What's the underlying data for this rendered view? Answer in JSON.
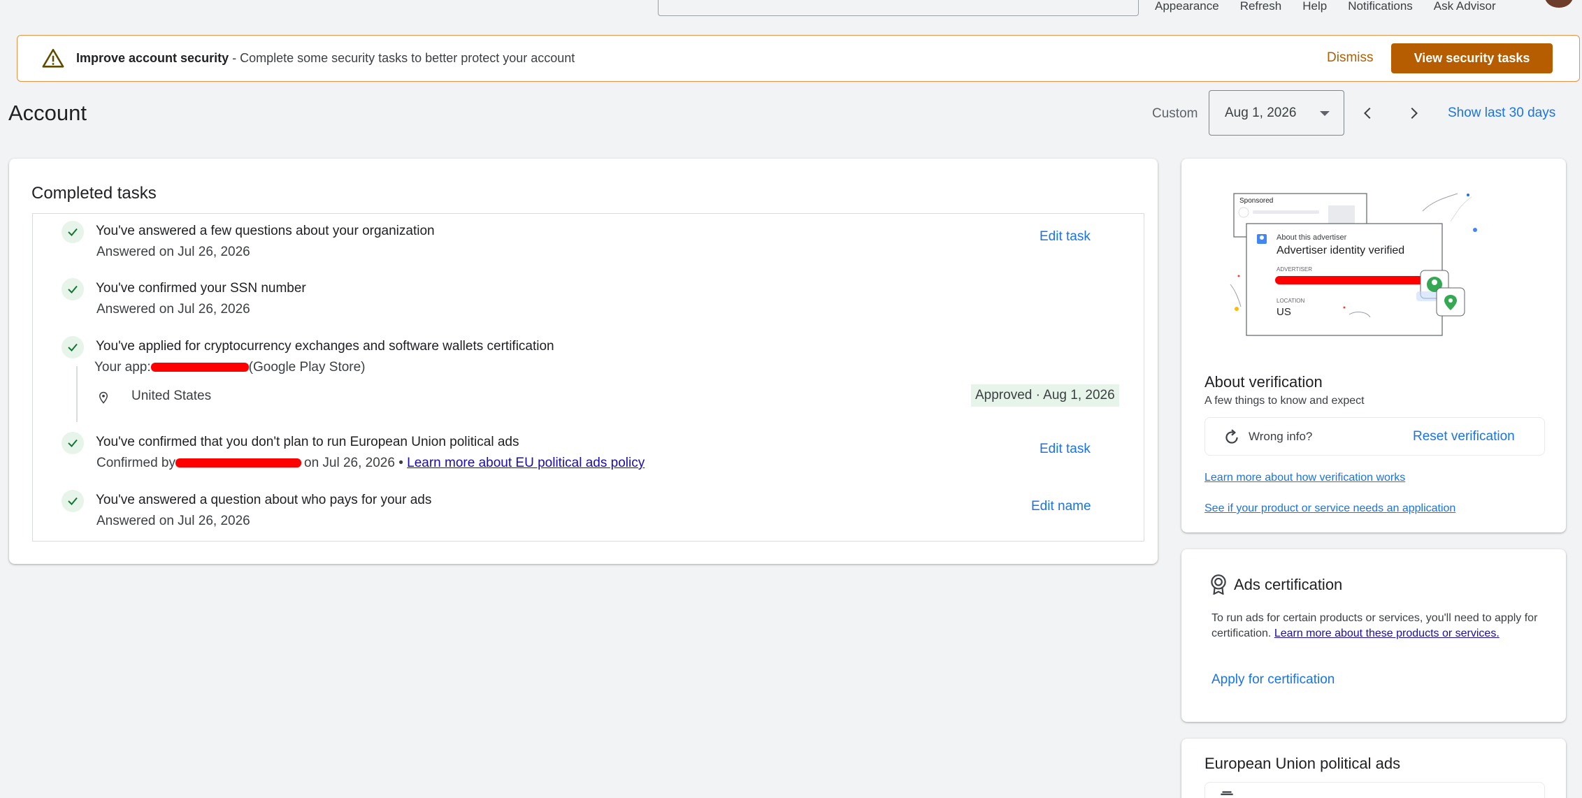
{
  "top_nav": {
    "items": [
      "Appearance",
      "Refresh",
      "Help",
      "Notifications",
      "Ask Advisor"
    ]
  },
  "banner": {
    "title": "Improve account security",
    "message": " - Complete some security tasks to better protect your account",
    "dismiss_label": "Dismiss",
    "action_label": "View security tasks",
    "accent_color": "#b55d00"
  },
  "header": {
    "title": "Account",
    "range_label": "Custom",
    "date_value": "Aug 1, 2026",
    "show_last_label": "Show last 30 days"
  },
  "tasks": {
    "title": "Completed tasks",
    "items": [
      {
        "title": "You've answered a few questions about your organization",
        "sub": "Answered on Jul 26, 2026",
        "action": "Edit task"
      },
      {
        "title": "You've confirmed your SSN number",
        "sub": "Answered on Jul 26, 2026"
      },
      {
        "title": "You've applied for cryptocurrency exchanges and software wallets certification",
        "app_prefix": "Your app:",
        "app_suffix": "(Google Play Store)",
        "location": "United States",
        "status": "Approved · Aug 1, 2026"
      },
      {
        "title": "You've confirmed that you don't plan to run European Union political ads",
        "sub_prefix": "Confirmed by",
        "sub_suffix": "on Jul 26, 2026 •",
        "link": "Learn more about EU political ads policy",
        "action": "Edit task"
      },
      {
        "title": "You've answered a question about who pays for your ads",
        "sub": "Answered on Jul 26, 2026",
        "action": "Edit name"
      }
    ]
  },
  "verification": {
    "illustration": {
      "sponsored": "Sponsored",
      "about": "About this advertiser",
      "verified": "Advertiser identity verified",
      "advertiser_label": "ADVERTISER",
      "location_label": "LOCATION",
      "location_value": "US"
    },
    "title": "About verification",
    "subtitle": "A few things to know and expect",
    "wrong_info": "Wrong info?",
    "reset_label": "Reset verification",
    "link1": "Learn more about how verification works",
    "link2": "See if your product or service needs an application"
  },
  "certification": {
    "title": "Ads certification",
    "body": "To run ads for certain products or services, you'll need to apply for certification. ",
    "link": "Learn more about these products or services.",
    "apply_label": "Apply for certification"
  },
  "eu_ads": {
    "title": "European Union political ads"
  }
}
